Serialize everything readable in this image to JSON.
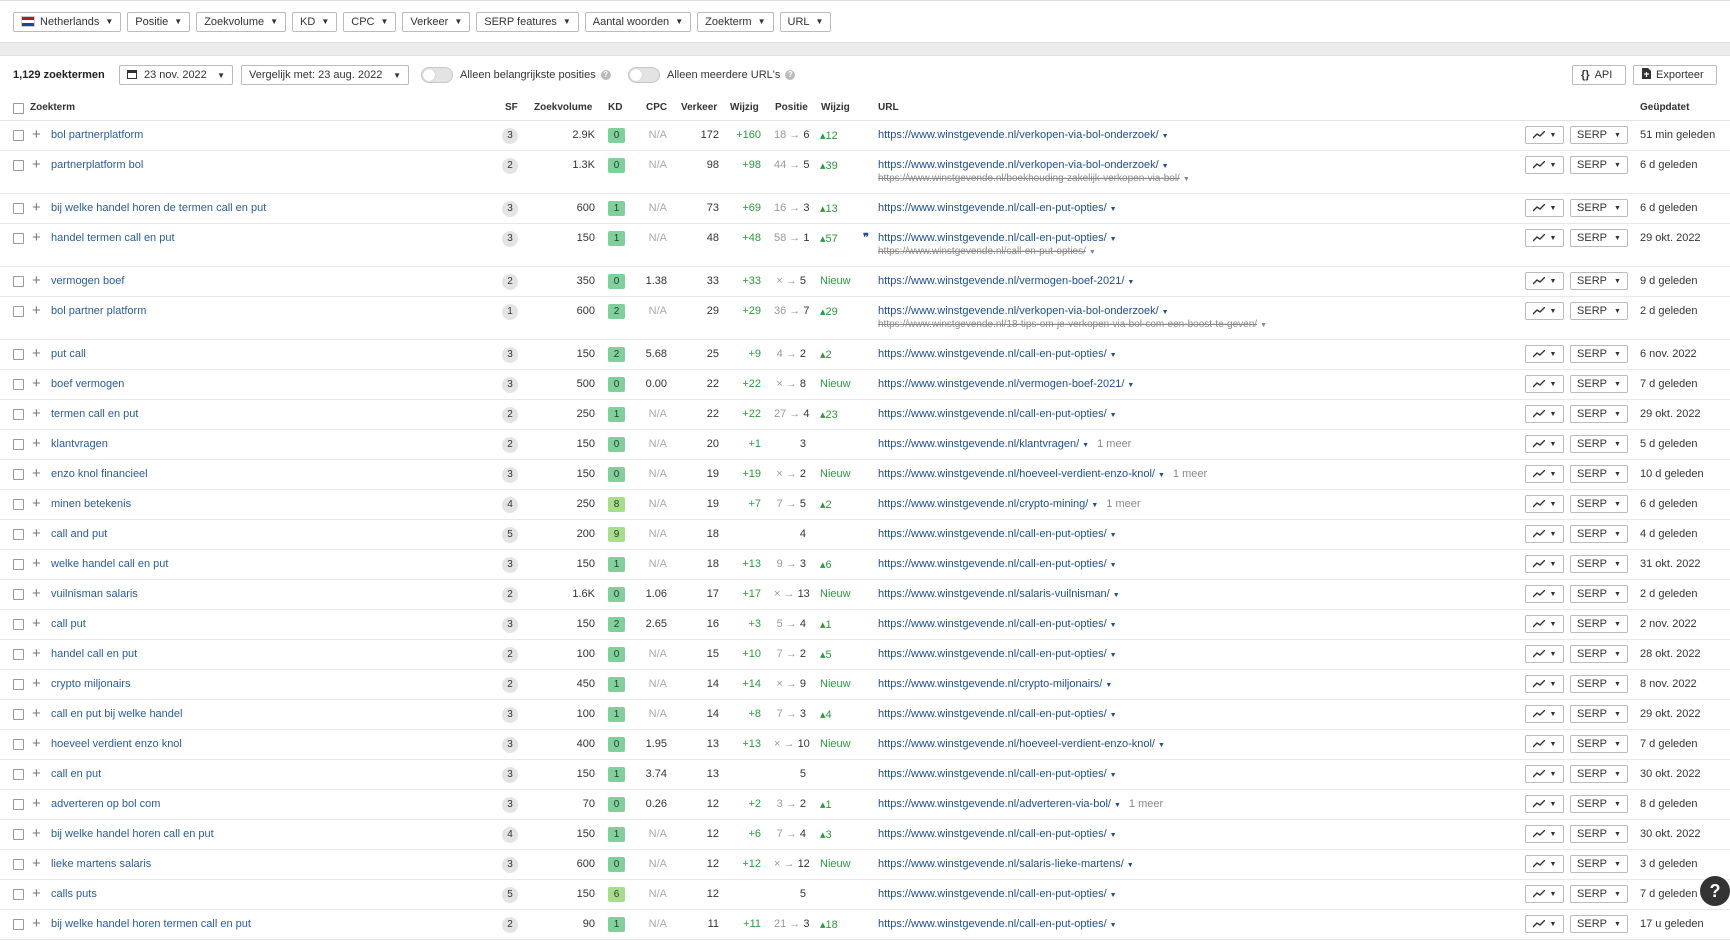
{
  "filters": [
    {
      "label": "Netherlands",
      "flag": true
    },
    {
      "label": "Positie"
    },
    {
      "label": "Zoekvolume"
    },
    {
      "label": "KD"
    },
    {
      "label": "CPC"
    },
    {
      "label": "Verkeer"
    },
    {
      "label": "SERP features"
    },
    {
      "label": "Aantal woorden"
    },
    {
      "label": "Zoekterm"
    },
    {
      "label": "URL"
    }
  ],
  "toolbar": {
    "count": "1,129 zoektermen",
    "date": "23 nov. 2022",
    "compare": "Vergelijk met: 23 aug. 2022",
    "toggle1": "Alleen belangrijkste posities",
    "toggle2": "Alleen meerdere URL's",
    "api": "API",
    "export": "Exporteer"
  },
  "columns": {
    "keyword": "Zoekterm",
    "sf": "SF",
    "volume": "Zoekvolume",
    "kd": "KD",
    "cpc": "CPC",
    "traffic": "Verkeer",
    "traffic_change": "Wijzig",
    "position": "Positie",
    "position_change": "Wijzig",
    "url": "URL",
    "updated": "Geüpdatet"
  },
  "colors": {
    "kd_green": "#7fd19b",
    "kd_yellow": "#a8dd8a",
    "link": "#1e4f8f",
    "positive": "#2b9a3f"
  },
  "rows": [
    {
      "kw": "bol partnerplatform",
      "sf": "3",
      "vol": "2.9K",
      "kd": "0",
      "cpc": "N/A",
      "trf": "172",
      "tch": "+160",
      "pos_old": "18",
      "pos": "6",
      "pch": "▴12",
      "url": "https://www.winstgevende.nl/verkopen-via-bol-onderzoek/",
      "upd": "51 min geleden"
    },
    {
      "kw": "partnerplatform bol",
      "sf": "2",
      "vol": "1.3K",
      "kd": "0",
      "cpc": "N/A",
      "trf": "98",
      "tch": "+98",
      "pos_old": "44",
      "pos": "5",
      "pch": "▴39",
      "url": "https://www.winstgevende.nl/verkopen-via-bol-onderzoek/",
      "url2": "https://www.winstgevende.nl/boekhouding-zakelijk-verkopen-via-bol/",
      "upd": "6 d geleden"
    },
    {
      "kw": "bij welke handel horen de termen call en put",
      "sf": "3",
      "vol": "600",
      "kd": "1",
      "cpc": "N/A",
      "trf": "73",
      "tch": "+69",
      "pos_old": "16",
      "pos": "3",
      "pch": "▴13",
      "url": "https://www.winstgevende.nl/call-en-put-opties/",
      "upd": "6 d geleden"
    },
    {
      "kw": "handel termen call en put",
      "sf": "3",
      "vol": "150",
      "kd": "1",
      "cpc": "N/A",
      "trf": "48",
      "tch": "+48",
      "pos_old": "58",
      "pos": "1",
      "pch": "▴57",
      "quote": true,
      "url": "https://www.winstgevende.nl/call-en-put-opties/",
      "url2": "https://www.winstgevende.nl/call-en-put-opties/",
      "upd": "29 okt. 2022"
    },
    {
      "kw": "vermogen boef",
      "sf": "2",
      "vol": "350",
      "kd": "0",
      "cpc": "1.38",
      "trf": "33",
      "tch": "+33",
      "pos_old": "×",
      "pos": "5",
      "pch": "Nieuw",
      "url": "https://www.winstgevende.nl/vermogen-boef-2021/",
      "upd": "9 d geleden"
    },
    {
      "kw": "bol partner platform",
      "sf": "1",
      "vol": "600",
      "kd": "2",
      "cpc": "N/A",
      "trf": "29",
      "tch": "+29",
      "pos_old": "36",
      "pos": "7",
      "pch": "▴29",
      "url": "https://www.winstgevende.nl/verkopen-via-bol-onderzoek/",
      "url2": "https://www.winstgevende.nl/18-tips-om-je-verkopen-via-bol-com-een-boost-te-geven/",
      "upd": "2 d geleden"
    },
    {
      "kw": "put call",
      "sf": "3",
      "vol": "150",
      "kd": "2",
      "cpc": "5.68",
      "trf": "25",
      "tch": "+9",
      "pos_old": "4",
      "pos": "2",
      "pch": "▴2",
      "url": "https://www.winstgevende.nl/call-en-put-opties/",
      "upd": "6 nov. 2022"
    },
    {
      "kw": "boef vermogen",
      "sf": "3",
      "vol": "500",
      "kd": "0",
      "cpc": "0.00",
      "trf": "22",
      "tch": "+22",
      "pos_old": "×",
      "pos": "8",
      "pch": "Nieuw",
      "url": "https://www.winstgevende.nl/vermogen-boef-2021/",
      "upd": "7 d geleden"
    },
    {
      "kw": "termen call en put",
      "sf": "2",
      "vol": "250",
      "kd": "1",
      "cpc": "N/A",
      "trf": "22",
      "tch": "+22",
      "pos_old": "27",
      "pos": "4",
      "pch": "▴23",
      "url": "https://www.winstgevende.nl/call-en-put-opties/",
      "upd": "29 okt. 2022"
    },
    {
      "kw": "klantvragen",
      "sf": "2",
      "vol": "150",
      "kd": "0",
      "cpc": "N/A",
      "trf": "20",
      "tch": "+1",
      "pos_old": "",
      "pos": "3",
      "pch": "",
      "url": "https://www.winstgevende.nl/klantvragen/",
      "more": "1 meer",
      "upd": "5 d geleden"
    },
    {
      "kw": "enzo knol financieel",
      "sf": "3",
      "vol": "150",
      "kd": "0",
      "cpc": "N/A",
      "trf": "19",
      "tch": "+19",
      "pos_old": "×",
      "pos": "2",
      "pch": "Nieuw",
      "url": "https://www.winstgevende.nl/hoeveel-verdient-enzo-knol/",
      "more": "1 meer",
      "upd": "10 d geleden"
    },
    {
      "kw": "minen betekenis",
      "sf": "4",
      "vol": "250",
      "kd": "8",
      "cpc": "N/A",
      "trf": "19",
      "tch": "+7",
      "pos_old": "7",
      "pos": "5",
      "pch": "▴2",
      "url": "https://www.winstgevende.nl/crypto-mining/",
      "more": "1 meer",
      "upd": "6 d geleden"
    },
    {
      "kw": "call and put",
      "sf": "5",
      "vol": "200",
      "kd": "9",
      "cpc": "N/A",
      "trf": "18",
      "tch": "",
      "pos_old": "",
      "pos": "4",
      "pch": "",
      "url": "https://www.winstgevende.nl/call-en-put-opties/",
      "upd": "4 d geleden"
    },
    {
      "kw": "welke handel call en put",
      "sf": "3",
      "vol": "150",
      "kd": "1",
      "cpc": "N/A",
      "trf": "18",
      "tch": "+13",
      "pos_old": "9",
      "pos": "3",
      "pch": "▴6",
      "url": "https://www.winstgevende.nl/call-en-put-opties/",
      "upd": "31 okt. 2022"
    },
    {
      "kw": "vuilnisman salaris",
      "sf": "2",
      "vol": "1.6K",
      "kd": "0",
      "cpc": "1.06",
      "trf": "17",
      "tch": "+17",
      "pos_old": "×",
      "pos": "13",
      "pch": "Nieuw",
      "url": "https://www.winstgevende.nl/salaris-vuilnisman/",
      "upd": "2 d geleden"
    },
    {
      "kw": "call put",
      "sf": "3",
      "vol": "150",
      "kd": "2",
      "cpc": "2.65",
      "trf": "16",
      "tch": "+3",
      "pos_old": "5",
      "pos": "4",
      "pch": "▴1",
      "url": "https://www.winstgevende.nl/call-en-put-opties/",
      "upd": "2 nov. 2022"
    },
    {
      "kw": "handel call en put",
      "sf": "2",
      "vol": "100",
      "kd": "0",
      "cpc": "N/A",
      "trf": "15",
      "tch": "+10",
      "pos_old": "7",
      "pos": "2",
      "pch": "▴5",
      "url": "https://www.winstgevende.nl/call-en-put-opties/",
      "upd": "28 okt. 2022"
    },
    {
      "kw": "crypto miljonairs",
      "sf": "2",
      "vol": "450",
      "kd": "1",
      "cpc": "N/A",
      "trf": "14",
      "tch": "+14",
      "pos_old": "×",
      "pos": "9",
      "pch": "Nieuw",
      "url": "https://www.winstgevende.nl/crypto-miljonairs/",
      "upd": "8 nov. 2022"
    },
    {
      "kw": "call en put bij welke handel",
      "sf": "3",
      "vol": "100",
      "kd": "1",
      "cpc": "N/A",
      "trf": "14",
      "tch": "+8",
      "pos_old": "7",
      "pos": "3",
      "pch": "▴4",
      "url": "https://www.winstgevende.nl/call-en-put-opties/",
      "upd": "29 okt. 2022"
    },
    {
      "kw": "hoeveel verdient enzo knol",
      "sf": "3",
      "vol": "400",
      "kd": "0",
      "cpc": "1.95",
      "trf": "13",
      "tch": "+13",
      "pos_old": "×",
      "pos": "10",
      "pch": "Nieuw",
      "url": "https://www.winstgevende.nl/hoeveel-verdient-enzo-knol/",
      "upd": "7 d geleden"
    },
    {
      "kw": "call en put",
      "sf": "3",
      "vol": "150",
      "kd": "1",
      "cpc": "3.74",
      "trf": "13",
      "tch": "",
      "pos_old": "",
      "pos": "5",
      "pch": "",
      "url": "https://www.winstgevende.nl/call-en-put-opties/",
      "upd": "30 okt. 2022"
    },
    {
      "kw": "adverteren op bol com",
      "sf": "3",
      "vol": "70",
      "kd": "0",
      "cpc": "0.26",
      "trf": "12",
      "tch": "+2",
      "pos_old": "3",
      "pos": "2",
      "pch": "▴1",
      "url": "https://www.winstgevende.nl/adverteren-via-bol/",
      "more": "1 meer",
      "upd": "8 d geleden"
    },
    {
      "kw": "bij welke handel horen call en put",
      "sf": "4",
      "vol": "150",
      "kd": "1",
      "cpc": "N/A",
      "trf": "12",
      "tch": "+6",
      "pos_old": "7",
      "pos": "4",
      "pch": "▴3",
      "url": "https://www.winstgevende.nl/call-en-put-opties/",
      "upd": "30 okt. 2022"
    },
    {
      "kw": "lieke martens salaris",
      "sf": "3",
      "vol": "600",
      "kd": "0",
      "cpc": "N/A",
      "trf": "12",
      "tch": "+12",
      "pos_old": "×",
      "pos": "12",
      "pch": "Nieuw",
      "url": "https://www.winstgevende.nl/salaris-lieke-martens/",
      "upd": "3 d geleden"
    },
    {
      "kw": "calls puts",
      "sf": "5",
      "vol": "150",
      "kd": "6",
      "cpc": "N/A",
      "trf": "12",
      "tch": "",
      "pos_old": "",
      "pos": "5",
      "pch": "",
      "url": "https://www.winstgevende.nl/call-en-put-opties/",
      "upd": "7 d geleden"
    },
    {
      "kw": "bij welke handel horen termen call en put",
      "sf": "2",
      "vol": "90",
      "kd": "1",
      "cpc": "N/A",
      "trf": "11",
      "tch": "+11",
      "pos_old": "21",
      "pos": "3",
      "pch": "▴18",
      "url": "https://www.winstgevende.nl/call-en-put-opties/",
      "upd": "17 u geleden"
    }
  ],
  "serp_label": "SERP",
  "help": "?"
}
